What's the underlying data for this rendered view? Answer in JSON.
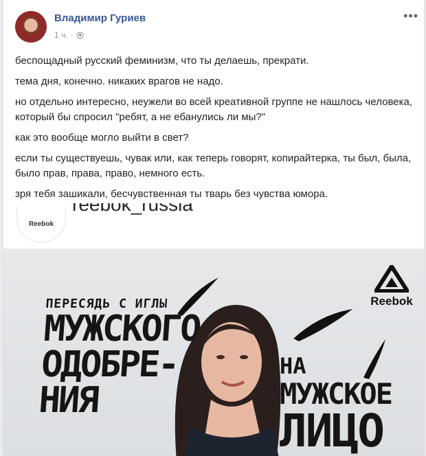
{
  "post": {
    "author_name": "Владимир Гуриев",
    "timestamp": "1 ч.",
    "visibility_icon": "globe-icon",
    "more_icon": "more-options-icon",
    "paragraphs": [
      "беспощадный русский феминизм, что ты делаешь, прекрати.",
      "тема дня, конечно. никаких врагов не надо.",
      "но отдельно интересно, неужели во всей креативной группе не нашлось человека, который бы спросил \"ребят, а не ебанулись ли мы?\"",
      "как это вообще могло выйти в свет?",
      "если ты существуешь, чувак или, как теперь говорят, копирайтерка, ты был, была, было прав, права, право, немного есть.",
      "зря тебя зашикали, бесчувственная ты тварь без чувства юмора."
    ]
  },
  "embed": {
    "avatar_text": "Reebok",
    "handle": "reebok_russia"
  },
  "ad": {
    "left_line1": "ПЕРЕСЯДЬ С ИГЛЫ",
    "left_line2": "МУЖСКОГО",
    "left_line3": "ОДОБРЕ-",
    "left_line4": "НИЯ",
    "right_line1": "НА",
    "right_line2": "МУЖСКОЕ",
    "right_line3": "ЛИЦО",
    "logo_text": "Reebok",
    "logo_icon": "reebok-delta-icon"
  },
  "colors": {
    "link_blue": "#365899",
    "text": "#1d2129",
    "meta_gray": "#90949c",
    "ad_bg": "#e2e4e6"
  }
}
